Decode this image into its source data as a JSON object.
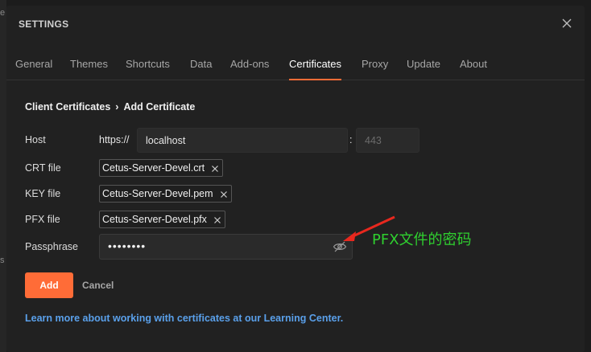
{
  "background": {
    "partial_chars": [
      "e",
      "s"
    ]
  },
  "modal": {
    "title": "SETTINGS",
    "tabs": [
      {
        "label": "General"
      },
      {
        "label": "Themes"
      },
      {
        "label": "Shortcuts"
      },
      {
        "label": "Data"
      },
      {
        "label": "Add-ons"
      },
      {
        "label": "Certificates",
        "active": true
      },
      {
        "label": "Proxy"
      },
      {
        "label": "Update"
      },
      {
        "label": "About"
      }
    ]
  },
  "breadcrumb": {
    "parent": "Client Certificates",
    "separator": "›",
    "current": "Add Certificate"
  },
  "form": {
    "host": {
      "label": "Host",
      "prefix": "https://",
      "value": "localhost",
      "port_separator": ":",
      "port_placeholder": "443"
    },
    "crt": {
      "label": "CRT file",
      "file": "Cetus-Server-Devel.crt"
    },
    "key": {
      "label": "KEY file",
      "file": "Cetus-Server-Devel.pem"
    },
    "pfx": {
      "label": "PFX file",
      "file": "Cetus-Server-Devel.pfx"
    },
    "passphrase": {
      "label": "Passphrase",
      "masked_value": "••••••••"
    }
  },
  "actions": {
    "add_label": "Add",
    "cancel_label": "Cancel"
  },
  "learn_more": "Learn more about working with certificates at our Learning Center.",
  "annotation": {
    "text": "PFX文件的密码",
    "color": "#2fd02f",
    "arrow_color": "#e8281e"
  },
  "colors": {
    "accent": "#ff6c37",
    "link": "#5aa0ea",
    "modal_bg": "#212121"
  },
  "icons": {
    "close": "close-icon",
    "remove": "remove-file-icon",
    "visibility": "eye-off-icon"
  }
}
